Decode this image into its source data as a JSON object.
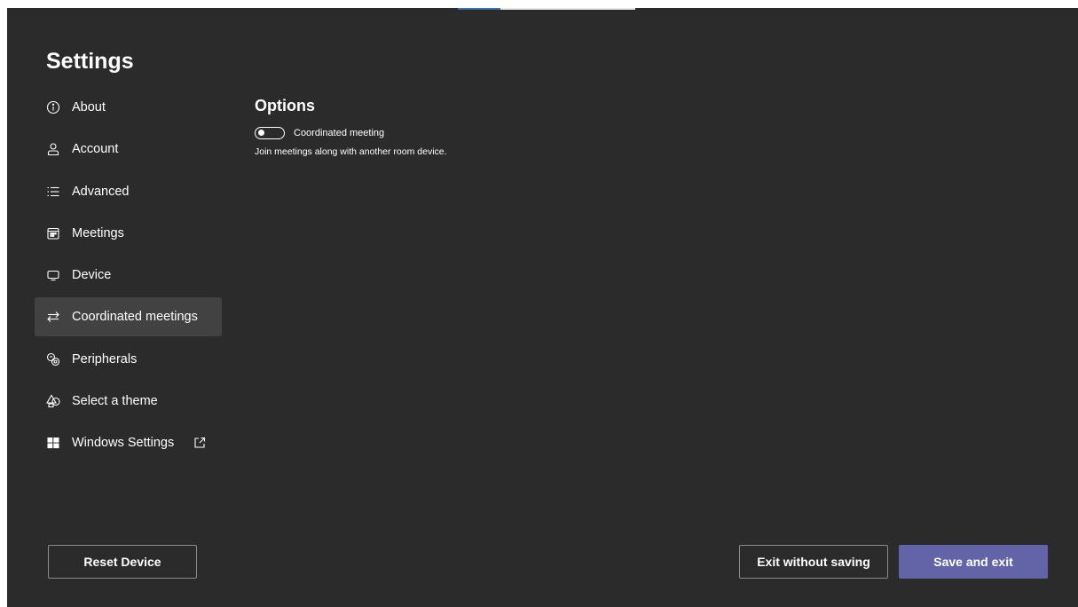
{
  "settings": {
    "title": "Settings"
  },
  "sidebar": {
    "items": [
      {
        "label": "About",
        "icon": "info-icon"
      },
      {
        "label": "Account",
        "icon": "person-icon"
      },
      {
        "label": "Advanced",
        "icon": "list-icon"
      },
      {
        "label": "Meetings",
        "icon": "calendar-icon"
      },
      {
        "label": "Device",
        "icon": "monitor-icon"
      },
      {
        "label": "Coordinated meetings",
        "icon": "arrows-swap-icon",
        "selected": true
      },
      {
        "label": "Peripherals",
        "icon": "peripherals-icon"
      },
      {
        "label": "Select a theme",
        "icon": "shapes-icon"
      },
      {
        "label": "Windows Settings",
        "icon": "windows-logo-icon",
        "external": "open-external-icon"
      }
    ]
  },
  "options": {
    "title": "Options",
    "toggle_label": "Coordinated meeting",
    "toggle_state": "off",
    "description": "Join meetings along with another room device."
  },
  "buttons": {
    "reset": "Reset Device",
    "exit": "Exit without saving",
    "save": "Save and exit"
  },
  "colors": {
    "background": "#2b2b2b",
    "selected_item": "#424242",
    "primary": "#6264a7",
    "text": "#ffffff"
  }
}
